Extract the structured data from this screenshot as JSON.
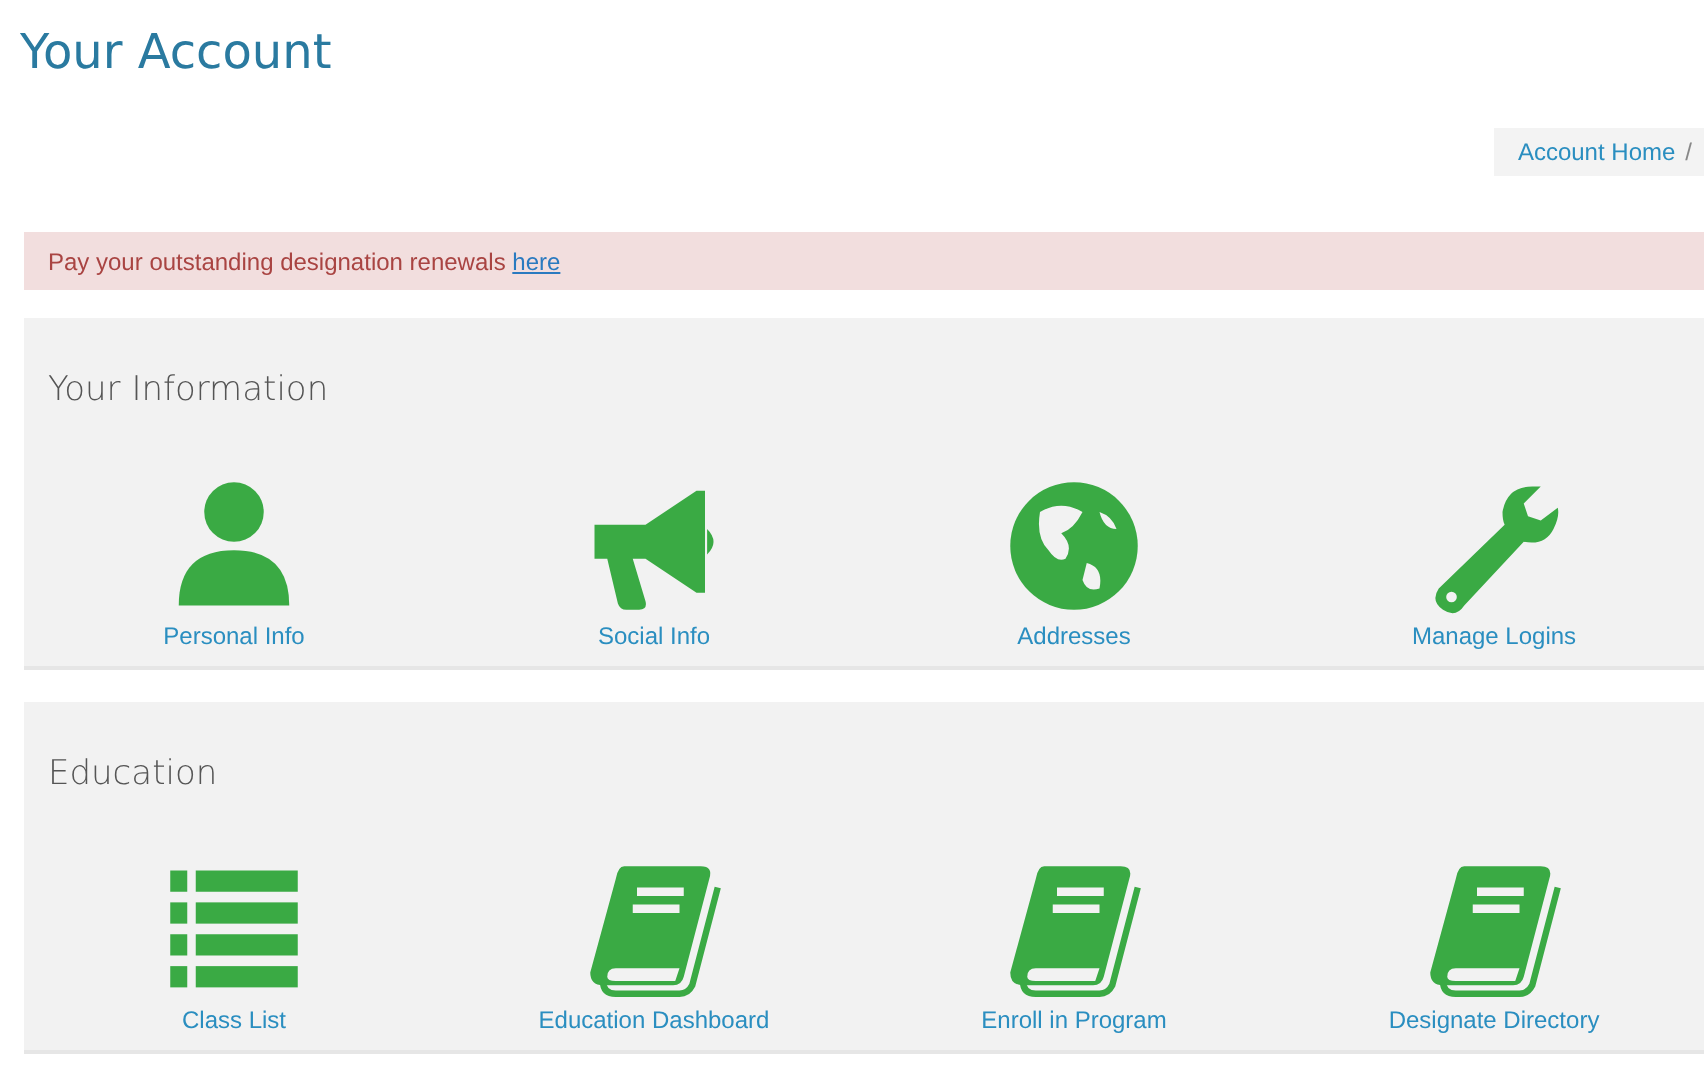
{
  "page_title": "Your Account",
  "breadcrumb": {
    "items": [
      "Account Home"
    ],
    "separator": "/"
  },
  "alert": {
    "text": "Pay your outstanding designation renewals",
    "link": "here"
  },
  "sections": [
    {
      "title": "Your Information",
      "tiles": [
        {
          "label": "Personal Info",
          "kind": "person"
        },
        {
          "label": "Social Info",
          "kind": "megaphone"
        },
        {
          "label": "Addresses",
          "kind": "globe"
        },
        {
          "label": "Manage Logins",
          "kind": "wrench"
        }
      ]
    },
    {
      "title": "Education",
      "tiles": [
        {
          "label": "Class List",
          "kind": "list"
        },
        {
          "label": "Education Dashboard",
          "kind": "book"
        },
        {
          "label": "Enroll in Program",
          "kind": "book"
        },
        {
          "label": "Designate Directory",
          "kind": "book"
        }
      ]
    }
  ]
}
